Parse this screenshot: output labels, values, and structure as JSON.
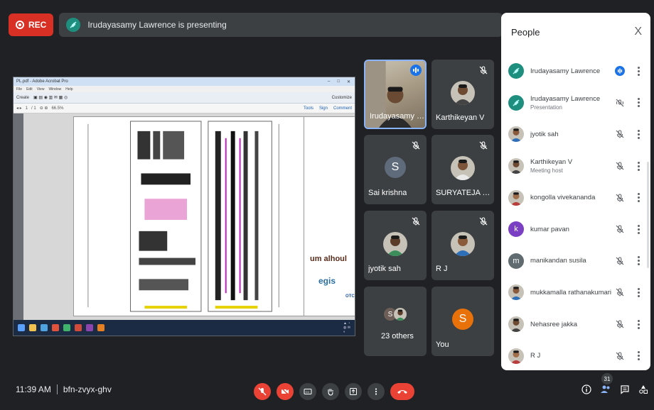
{
  "top": {
    "rec_label": "REC",
    "presenting_text": "Irudayasamy Lawrence is presenting"
  },
  "shared_screen": {
    "window_title": "PL.pdf - Adobe Acrobat Pro",
    "menu": [
      "File",
      "Edit",
      "View",
      "Window",
      "Help"
    ],
    "create_label": "Create",
    "customize_label": "Customize",
    "page_current": "1",
    "page_total": "/ 1",
    "zoom": "66.5%",
    "tools_right": [
      "Tools",
      "Sign",
      "Comment"
    ],
    "logo1": "um alhoul",
    "logo2": "egis",
    "logo3": "OTC"
  },
  "tiles": [
    {
      "name": "Irudayasamy L...",
      "kind": "camera",
      "speaking": true
    },
    {
      "name": "Karthikeyan V",
      "kind": "photo",
      "muted": true
    },
    {
      "name": "Sai krishna",
      "kind": "letter",
      "letter": "S",
      "color": "#5f6b7a",
      "muted": true
    },
    {
      "name": "SURYATEJA PULI...",
      "kind": "photo",
      "muted": true
    },
    {
      "name": "jyotik sah",
      "kind": "photo",
      "muted": true
    },
    {
      "name": "R J",
      "kind": "photo",
      "muted": true
    },
    {
      "name": "23 others",
      "kind": "others",
      "letter": "S"
    },
    {
      "name": "You",
      "kind": "letter",
      "letter": "S",
      "color": "#e8710a"
    }
  ],
  "panel": {
    "title": "People",
    "close": "X",
    "people": [
      {
        "name": "Irudayasamy Lawrence",
        "sub": "",
        "avatar": "feather",
        "mic": "speaking"
      },
      {
        "name": "Irudayasamy Lawrence",
        "sub": "Presentation",
        "avatar": "feather",
        "mic": "present"
      },
      {
        "name": "jyotik sah",
        "sub": "",
        "avatar": "photo",
        "mic": "muted"
      },
      {
        "name": "Karthikeyan V",
        "sub": "Meeting host",
        "avatar": "photo",
        "mic": "muted"
      },
      {
        "name": "kongolla vivekananda",
        "sub": "",
        "avatar": "photo",
        "mic": "muted"
      },
      {
        "name": "kumar pavan",
        "sub": "",
        "avatar": "letter",
        "letter": "k",
        "color": "#7b3fc4",
        "mic": "muted"
      },
      {
        "name": "manikandan susila",
        "sub": "",
        "avatar": "letter",
        "letter": "m",
        "color": "#5f6b6f",
        "mic": "muted"
      },
      {
        "name": "mukkamalla rathanakumari",
        "sub": "",
        "avatar": "photo",
        "mic": "muted"
      },
      {
        "name": "Nehasree jakka",
        "sub": "",
        "avatar": "photo",
        "mic": "muted"
      },
      {
        "name": "R J",
        "sub": "",
        "avatar": "photo",
        "mic": "muted"
      }
    ]
  },
  "bottom": {
    "time": "11:39 AM",
    "meeting_code": "bfn-zvyx-ghv",
    "participant_count": "31"
  },
  "colors": {
    "accent": "#1a73e8",
    "danger": "#ea4335",
    "bg": "#202124",
    "tile": "#3c4043"
  }
}
